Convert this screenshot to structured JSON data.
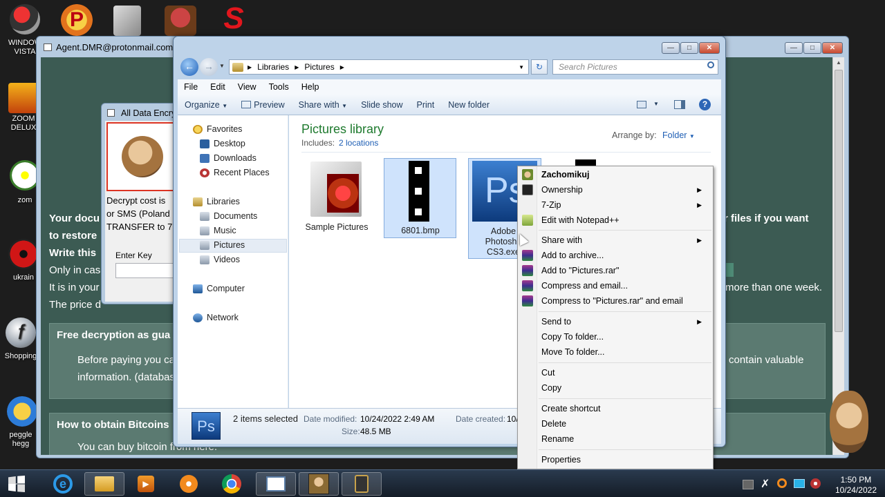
{
  "desktop": {
    "icons": [
      {
        "label": "WINDOW VISTA"
      },
      {
        "label": "ZOOM DELUX"
      },
      {
        "label": "zom"
      },
      {
        "label": "ukrain"
      },
      {
        "label": "Shopping"
      },
      {
        "label": "peggle hegg"
      }
    ]
  },
  "ransom": {
    "title": "Agent.DMR@protonmail.com",
    "line1": "Your docu",
    "line1_right": "r files if you want",
    "line2": "to restore",
    "line3": "Write this",
    "line4": "Only in case",
    "line5": "It is in your",
    "line5_right": "more than one week.",
    "line6": "The price d",
    "panel1_title": "Free decryption as gua",
    "panel1_text": "Before paying you ca",
    "panel1_right": "contain valuable",
    "panel1_text2": "information. (databas",
    "panel2_title": "How to obtain Bitcoins",
    "panel2_text": "You can buy bitcoin from here."
  },
  "decrypt": {
    "title": "All Data Encry",
    "text1": "Decrypt cost is",
    "text2": "or SMS (Poland",
    "text3": "TRANSFER to 7",
    "key_label": "Enter Key"
  },
  "explorer": {
    "breadcrumb": [
      "Libraries",
      "Pictures"
    ],
    "search_placeholder": "Search Pictures",
    "menu": [
      "File",
      "Edit",
      "View",
      "Tools",
      "Help"
    ],
    "toolbar": [
      "Organize",
      "Preview",
      "Share with",
      "Slide show",
      "Print",
      "New folder"
    ],
    "nav": {
      "favorites": "Favorites",
      "desktop": "Desktop",
      "downloads": "Downloads",
      "recent": "Recent Places",
      "libraries": "Libraries",
      "documents": "Documents",
      "music": "Music",
      "pictures": "Pictures",
      "videos": "Videos",
      "computer": "Computer",
      "network": "Network"
    },
    "library_title": "Pictures library",
    "includes_label": "Includes:",
    "includes_link": "2 locations",
    "arrange_label": "Arrange by:",
    "arrange_value": "Folder",
    "items": [
      {
        "name": "Sample Pictures"
      },
      {
        "name": "6801.bmp"
      },
      {
        "name1": "Adobe",
        "name2": "Photosho",
        "name3": "CS3.exe"
      }
    ],
    "details": {
      "selected": "2 items selected",
      "modified_label": "Date modified:",
      "modified_value": "10/24/2022 2:49 AM",
      "created_label": "Date created:",
      "created_value": "10/",
      "size_label": "Size:",
      "size_value": "48.5 MB"
    }
  },
  "context_menu": {
    "zachomikuj": "Zachomikuj",
    "ownership": "Ownership",
    "zip": "7-Zip",
    "notepad": "Edit with Notepad++",
    "share": "Share with",
    "add_archive": "Add to archive...",
    "add_rar": "Add to \"Pictures.rar\"",
    "compress_email": "Compress and email...",
    "compress_rar_email": "Compress to \"Pictures.rar\" and email",
    "send_to": "Send to",
    "copy_to": "Copy To folder...",
    "move_to": "Move To folder...",
    "cut": "Cut",
    "copy": "Copy",
    "create_shortcut": "Create shortcut",
    "delete": "Delete",
    "rename": "Rename",
    "properties": "Properties"
  },
  "taskbar": {
    "time": "1:50 PM",
    "date": "10/24/2022"
  }
}
